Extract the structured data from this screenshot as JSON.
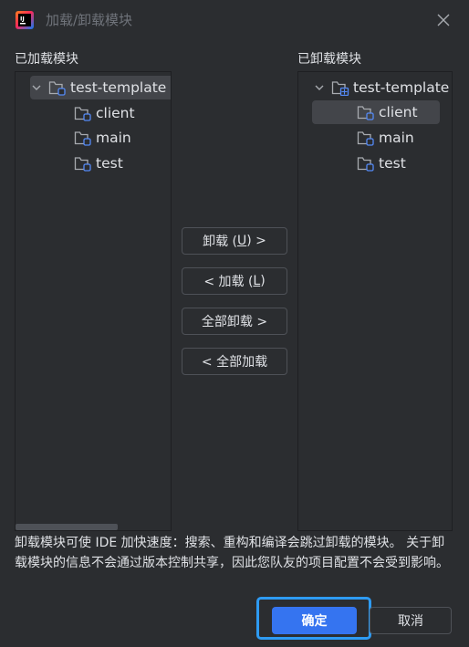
{
  "window": {
    "title": "加载/卸载模块",
    "app_icon": "intellij-idea-icon",
    "close_icon": "close-icon"
  },
  "loaded_panel": {
    "label": "已加载模块",
    "root": {
      "name": "test-template",
      "icon": "module-folder-icon",
      "expanded": true
    },
    "children": [
      {
        "name": "client",
        "icon": "module-folder-icon"
      },
      {
        "name": "main",
        "icon": "module-folder-icon"
      },
      {
        "name": "test",
        "icon": "module-folder-icon"
      }
    ]
  },
  "unloaded_panel": {
    "label": "已卸载模块",
    "root": {
      "name": "test-template",
      "icon": "unloaded-module-folder-icon",
      "expanded": true
    },
    "children": [
      {
        "name": "client",
        "icon": "module-folder-icon",
        "selected": true
      },
      {
        "name": "main",
        "icon": "module-folder-icon"
      },
      {
        "name": "test",
        "icon": "module-folder-icon"
      }
    ]
  },
  "actions": {
    "unload": {
      "prefix": "卸载 (",
      "mnemonic": "U",
      "suffix": ") >"
    },
    "load": {
      "prefix": "< 加载 (",
      "mnemonic": "L",
      "suffix": ")"
    },
    "unload_all": "全部卸载 >",
    "load_all": "< 全部加载"
  },
  "info": {
    "text": "卸载模块可使 IDE 加快速度：搜索、重构和编译会跳过卸载的模块。 关于卸载模块的信息不会通过版本控制共享，因此您队友的项目配置不会受到影响。"
  },
  "footer": {
    "ok_label": "确定",
    "cancel_label": "取消"
  },
  "colors": {
    "background": "#2b2d30",
    "accent": "#3574f0",
    "focus_ring": "#2e9bf3",
    "selection": "#43454a"
  }
}
